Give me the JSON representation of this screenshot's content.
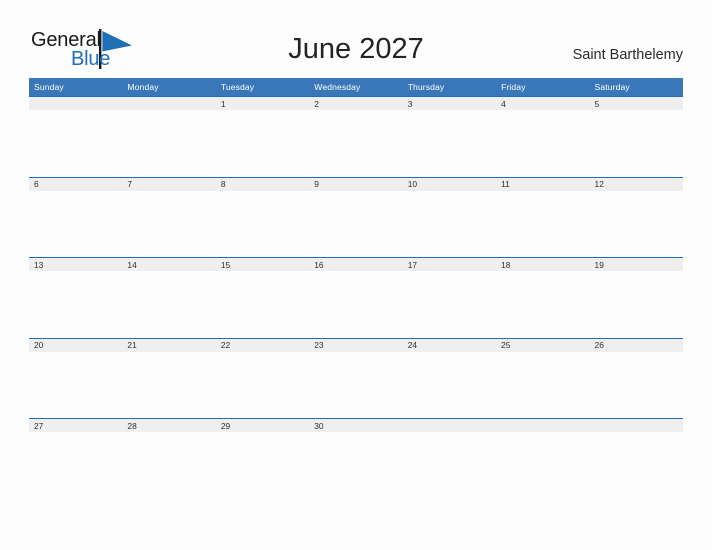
{
  "brand": {
    "name_part1": "General",
    "name_part2": "Blue",
    "flag_icon": "blue-triangle-flag",
    "color_dark": "#1a1a1a",
    "color_blue": "#1f6fb5"
  },
  "header": {
    "title": "June 2027",
    "location": "Saint Barthelemy"
  },
  "calendar": {
    "month": "June",
    "year": "2027",
    "header_bg": "#3a77b8",
    "row_divider": "#1f6fb5",
    "band_bg": "#efefef",
    "weekdays": [
      "Sunday",
      "Monday",
      "Tuesday",
      "Wednesday",
      "Thursday",
      "Friday",
      "Saturday"
    ],
    "weeks": [
      [
        "",
        "",
        "1",
        "2",
        "3",
        "4",
        "5"
      ],
      [
        "6",
        "7",
        "8",
        "9",
        "10",
        "11",
        "12"
      ],
      [
        "13",
        "14",
        "15",
        "16",
        "17",
        "18",
        "19"
      ],
      [
        "20",
        "21",
        "22",
        "23",
        "24",
        "25",
        "26"
      ],
      [
        "27",
        "28",
        "29",
        "30",
        "",
        "",
        ""
      ]
    ]
  }
}
